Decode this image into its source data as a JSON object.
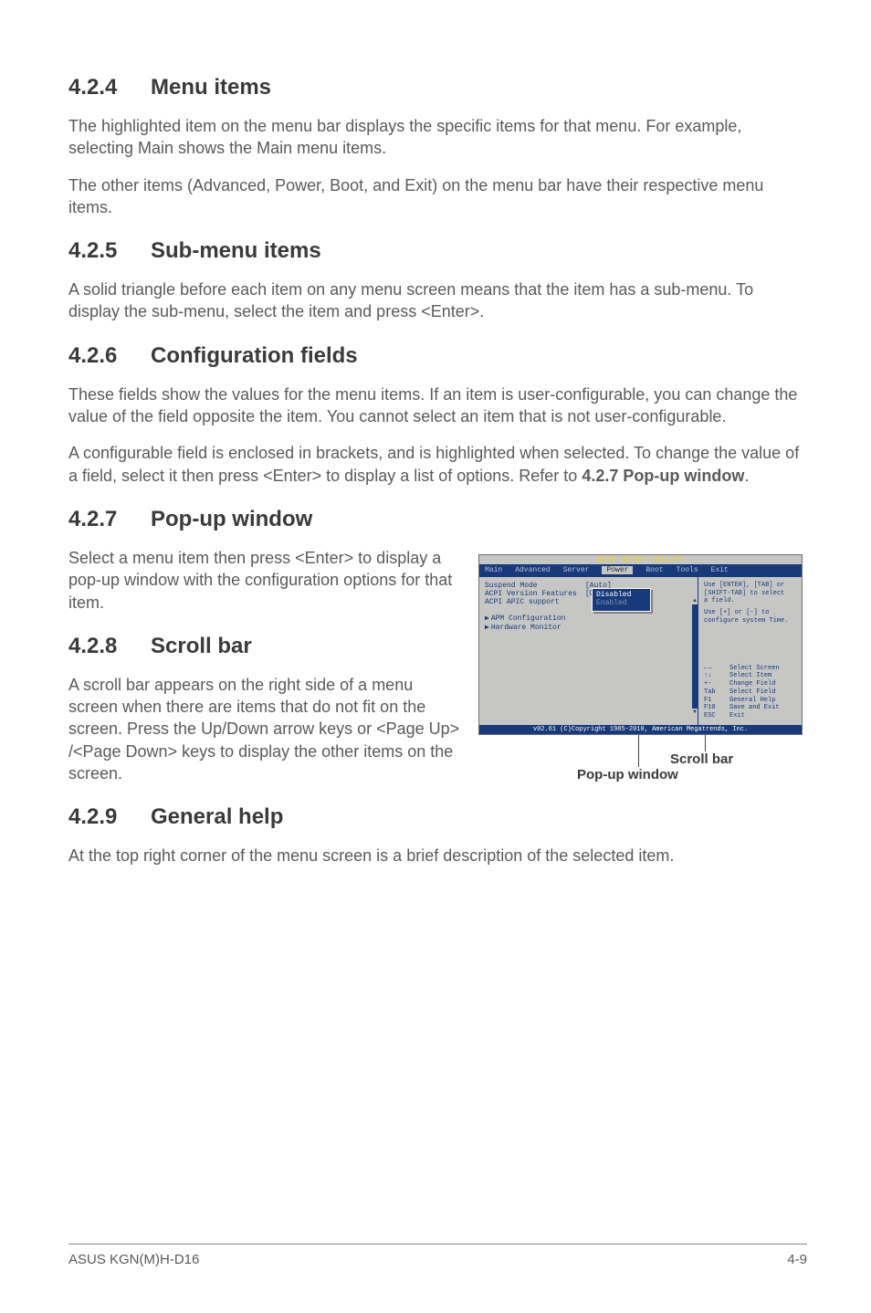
{
  "sections": {
    "s424": {
      "num": "4.2.4",
      "title": "Menu items",
      "p1": "The highlighted item on the menu bar displays the specific items for that menu. For example, selecting Main shows the Main menu items.",
      "p2": "The other items (Advanced, Power, Boot, and Exit) on the menu bar have their respective menu items."
    },
    "s425": {
      "num": "4.2.5",
      "title": "Sub-menu items",
      "p1": "A solid triangle before each item on any menu screen means that the item has a sub-menu. To display the sub-menu, select the item and press <Enter>."
    },
    "s426": {
      "num": "4.2.6",
      "title": "Configuration fields",
      "p1": "These fields show the values for the menu items. If an item is user-configurable, you can change the value of the field opposite the item. You cannot select an item that is not user-configurable.",
      "p2a": "A configurable field is enclosed in brackets, and is highlighted when selected. To change the value of a field, select it then press <Enter> to display a list of options. Refer to ",
      "p2b": "4.2.7 Pop-up window",
      "p2c": "."
    },
    "s427": {
      "num": "4.2.7",
      "title": "Pop-up window",
      "p1": "Select a menu item then press <Enter> to display a pop-up window with the configuration options for that item."
    },
    "s428": {
      "num": "4.2.8",
      "title": "Scroll bar",
      "p1": "A scroll bar appears on the right side of a menu screen when there are items that do not fit on the screen. Press the Up/Down arrow keys or <Page Up> /<Page Down> keys to display the other items on the screen."
    },
    "s429": {
      "num": "4.2.9",
      "title": "General help",
      "p1": "At the top right corner of the menu screen is a brief description of the selected item."
    }
  },
  "bios": {
    "title": "BIOS SETUP UTILITY",
    "tabs": [
      "Main",
      "Advanced",
      "Server",
      "Power",
      "Boot",
      "Tools",
      "Exit"
    ],
    "items": [
      {
        "k": "Suspend Mode",
        "v": "[Auto]"
      },
      {
        "k": "ACPI Version Features",
        "v": "[Disabled]"
      },
      {
        "k": "ACPI APIC support",
        "v": ""
      }
    ],
    "popup": {
      "opt1": "Disabled",
      "opt2": "Enabled"
    },
    "sub": [
      "APM Configuration",
      "Hardware Monitor"
    ],
    "help": {
      "l1": "Use [ENTER], [TAB] or",
      "l2": "[SHIFT-TAB] to select",
      "l3": "a field.",
      "l4": "Use [+] or [-] to",
      "l5": "configure system Time."
    },
    "legend": [
      {
        "k": "←→",
        "v": "Select Screen"
      },
      {
        "k": "↑↓",
        "v": "Select Item"
      },
      {
        "k": "+-",
        "v": "Change Field"
      },
      {
        "k": "Tab",
        "v": "Select Field"
      },
      {
        "k": "F1",
        "v": "General Help"
      },
      {
        "k": "F10",
        "v": "Save and Exit"
      },
      {
        "k": "ESC",
        "v": "Exit"
      }
    ],
    "footer": "v02.61 (C)Copyright 1985-2010, American Megatrends, Inc."
  },
  "callouts": {
    "scrollbar": "Scroll bar",
    "popup": "Pop-up window"
  },
  "pageFooter": {
    "left": "ASUS KGN(M)H-D16",
    "right": "4-9"
  }
}
